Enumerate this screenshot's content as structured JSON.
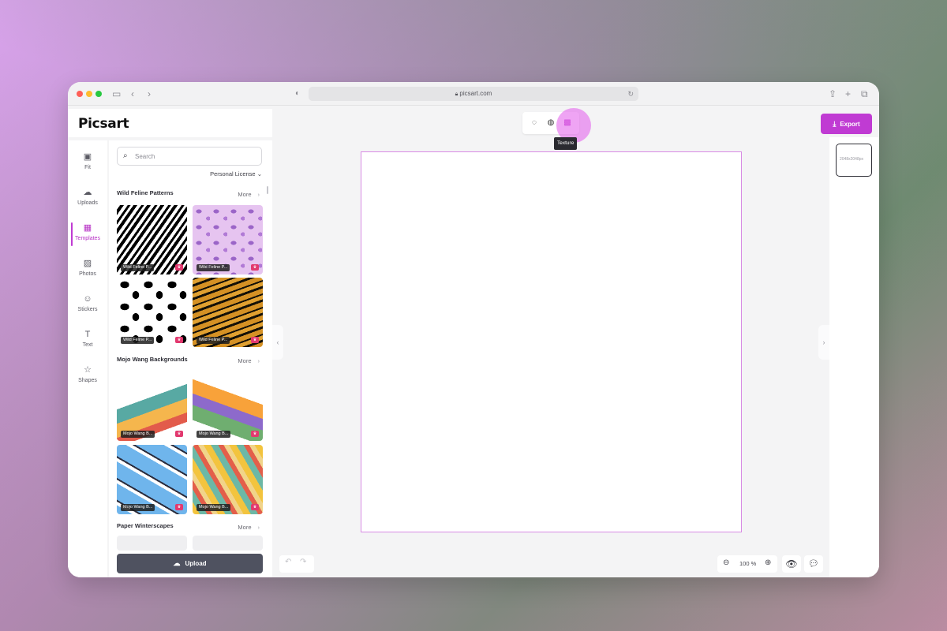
{
  "browser": {
    "url": "picsart.com",
    "lock_icon": "lock-icon",
    "reload_icon": "reload-icon"
  },
  "app": {
    "logo": "Picsart",
    "sidebar": {
      "items": [
        {
          "label": "Fit",
          "icon": "fit-icon"
        },
        {
          "label": "Uploads",
          "icon": "upload-cloud-icon"
        },
        {
          "label": "Templates",
          "icon": "templates-icon"
        },
        {
          "label": "Photos",
          "icon": "photos-icon"
        },
        {
          "label": "Stickers",
          "icon": "stickers-icon"
        },
        {
          "label": "Text",
          "icon": "text-icon"
        },
        {
          "label": "Shapes",
          "icon": "shapes-icon"
        }
      ],
      "active": "Templates"
    },
    "panel": {
      "search_placeholder": "Search",
      "license_label": "Personal License",
      "more_label": "More",
      "sections": [
        {
          "title": "Wild Feline Patterns",
          "tiles": [
            {
              "caption": "Wild Feline P..."
            },
            {
              "caption": "Wild Feline P..."
            },
            {
              "caption": "Wild Feline P..."
            },
            {
              "caption": "Wild Feline P..."
            }
          ]
        },
        {
          "title": "Mojo Wang Backgrounds",
          "tiles": [
            {
              "caption": "Mojo Wang B..."
            },
            {
              "caption": "Mojo Wang B..."
            },
            {
              "caption": "Mojo Wang B..."
            },
            {
              "caption": "Mojo Wang B..."
            }
          ]
        },
        {
          "title": "Paper Winterscapes",
          "tiles": []
        }
      ],
      "upload_label": "Upload"
    },
    "toolbar": {
      "tooltip": "Texture"
    },
    "export_label": "Export",
    "thumbnail_label": "2048x2048px",
    "zoom": "100 %",
    "colors": {
      "accent": "#c03bd3",
      "canvas_border": "#d88be4",
      "upload_button": "#4f5260"
    }
  }
}
